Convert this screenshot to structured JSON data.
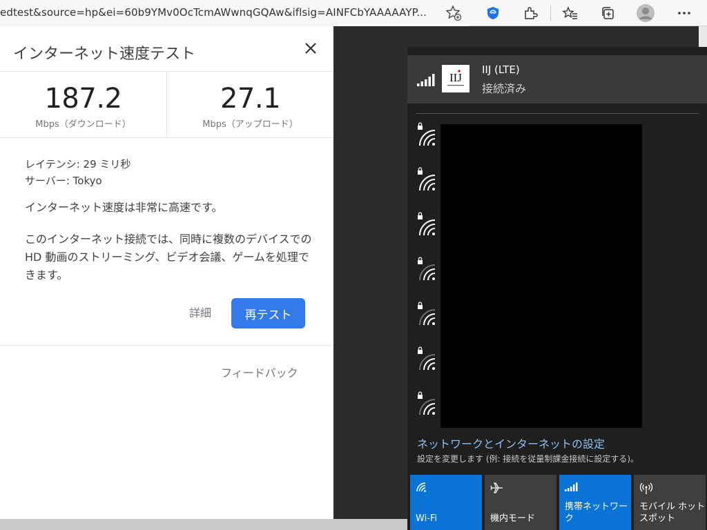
{
  "browser": {
    "url": "edtest&source=hp&ei=60b9YMv0OcTcmAWwnqGQAw&iflsig=AINFCbYAAAAAYP...",
    "icons": [
      "add-favorite-icon",
      "shield-extension-icon",
      "extensions-icon",
      "favorites-icon",
      "collections-icon",
      "profile-icon",
      "more-icon"
    ]
  },
  "speedtest": {
    "title": "インターネット速度テスト",
    "download": {
      "value": "187.2",
      "label": "Mbps（ダウンロード）"
    },
    "upload": {
      "value": "27.1",
      "label": "Mbps（アップロード）"
    },
    "latency": "レイテンシ: 29 ミリ秒",
    "server": "サーバー: Tokyo",
    "summary": "インターネット速度は非常に高速です。",
    "description": "このインターネット接続では、同時に複数のデバイスでの HD 動画のストリーミング、ビデオ会議、ゲームを処理できます。",
    "details_label": "詳細",
    "retest_label": "再テスト",
    "feedback_label": "フィードバック",
    "accent": "#3479e8"
  },
  "network": {
    "connected": {
      "name": "IIJ (LTE)",
      "status": "接続済み",
      "logo_text": "IIJ"
    },
    "wifi_count": 7,
    "settings_title": "ネットワークとインターネットの設定",
    "settings_sub": "設定を変更します (例: 接続を従量制課金接続に設定する)。",
    "quick_actions": [
      {
        "label": "Wi-Fi",
        "icon": "wifi-icon",
        "active": true
      },
      {
        "label": "機内モード",
        "icon": "airplane-icon",
        "active": false
      },
      {
        "label": "携帯ネットワーク",
        "icon": "cellular-icon",
        "active": true
      },
      {
        "label": "モバイル ホットスポット",
        "icon": "hotspot-icon",
        "active": false
      }
    ],
    "accent": "#0a74d6"
  }
}
